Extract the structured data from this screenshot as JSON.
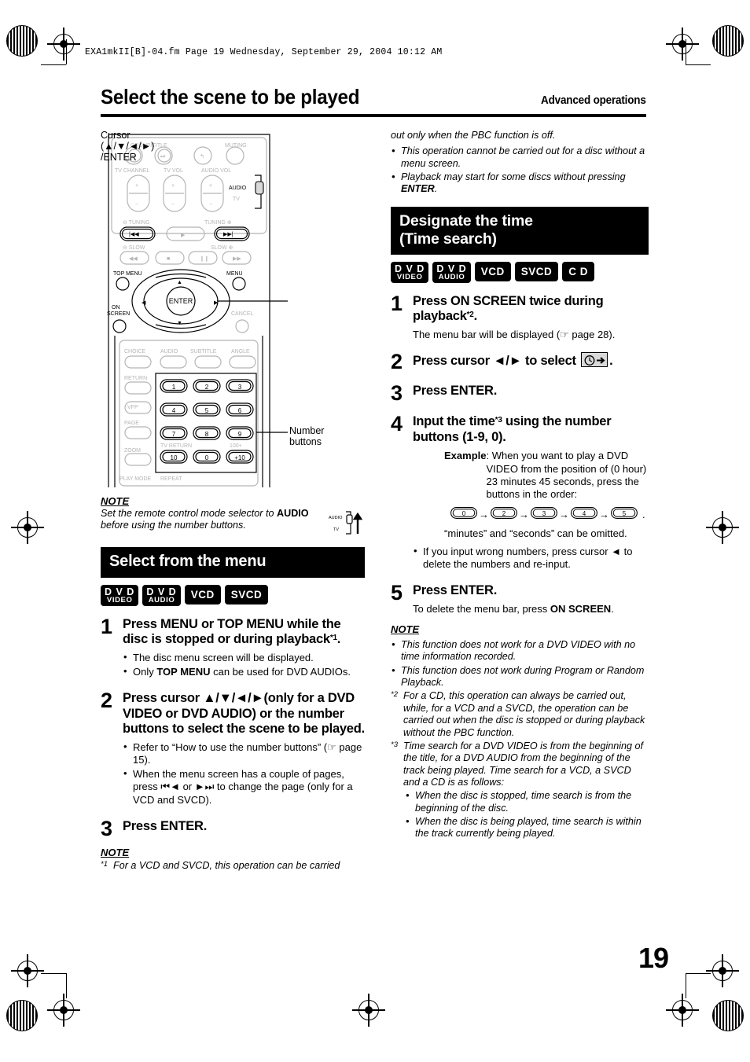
{
  "file_header": "EXA1mkII[B]-04.fm  Page 19  Wednesday, September 29, 2004  10:12 AM",
  "title": {
    "main": "Select the scene to be played",
    "section": "Advanced operations"
  },
  "page_number": "19",
  "remote": {
    "labels": {
      "group_title": "GROUP/TITLE",
      "muting": "MUTING",
      "tv_channel": "TV CHANNEL",
      "tv_vol": "TV VOL",
      "audio_vol": "AUDIO VOL",
      "audio": "AUDIO",
      "tv": "TV",
      "tuning_left": "TUNING",
      "tuning_right": "TUNING",
      "slow_left": "SLOW",
      "slow_right": "SLOW",
      "top_menu": "TOP MENU",
      "menu": "MENU",
      "enter": "ENTER",
      "on_screen": "ON\nSCREEN",
      "cancel": "CANCEL",
      "choice": "CHOICE",
      "audio_btn": "AUDIO",
      "subtitle": "SUBTITLE",
      "angle": "ANGLE",
      "return": "RETURN",
      "vfp": "VFP",
      "page": "PAGE",
      "zoom": "ZOOM",
      "tv_return": "TV RETURN",
      "hundred_plus": "100+",
      "play_mode": "PLAY MODE",
      "repeat": "REPEAT"
    },
    "keys": [
      "1",
      "2",
      "3",
      "4",
      "5",
      "6",
      "7",
      "8",
      "9",
      "10",
      "0",
      "+10"
    ],
    "callouts": {
      "cursor": [
        "Cursor",
        "(▲/▼/◄/►)",
        "/ENTER"
      ],
      "number": [
        "Number",
        "buttons"
      ]
    }
  },
  "left_column": {
    "note_top": {
      "head": "NOTE",
      "text_a": "Set the remote control mode selector to ",
      "text_b": "AUDIO",
      "text_c": " before using the number buttons.",
      "selector_audio": "AUDIO",
      "selector_tv": "TV"
    },
    "banner": "Select from the menu",
    "badges": [
      {
        "type": "two",
        "line1": "D V D",
        "line2": "VIDEO"
      },
      {
        "type": "two",
        "line1": "D V D",
        "line2": "AUDIO"
      },
      {
        "type": "one",
        "label": "VCD"
      },
      {
        "type": "one",
        "label": "SVCD"
      }
    ],
    "steps": [
      {
        "num": "1",
        "title": "Press MENU or TOP MENU while the disc is stopped or during playback",
        "sup": "*1",
        "title_end": ".",
        "bullets": [
          {
            "parts": [
              {
                "t": "The disc menu screen will be displayed."
              }
            ]
          },
          {
            "parts": [
              {
                "t": "Only "
              },
              {
                "t": "TOP MENU",
                "b": true
              },
              {
                "t": " can be used for DVD AUDIOs."
              }
            ]
          }
        ]
      },
      {
        "num": "2",
        "title": "Press cursor ▲/▼/◄/►(only for a DVD VIDEO or DVD AUDIO) or the number buttons to select the scene to be played.",
        "bullets": [
          {
            "parts": [
              {
                "t": "Refer to “How to use the number buttons” (☞ page 15)."
              }
            ]
          },
          {
            "parts": [
              {
                "t": "When the menu screen has a couple of pages, press ⏮◄ or ►⏭ to change the page (only for a VCD and SVCD)."
              }
            ]
          }
        ]
      },
      {
        "num": "3",
        "title": "Press ENTER."
      }
    ],
    "note_bottom": {
      "head": "NOTE",
      "marker": "*1",
      "text": "For a VCD and SVCD, this operation can be carried"
    }
  },
  "right_column": {
    "continued": {
      "first_line": "out only when the PBC function is off.",
      "bullets": [
        {
          "parts": [
            {
              "t": "This operation cannot be carried out for a disc without a menu screen."
            }
          ]
        },
        {
          "parts": [
            {
              "t": "Playback may start for some discs without pressing "
            },
            {
              "t": "ENTER",
              "b": true
            },
            {
              "t": "."
            }
          ]
        }
      ]
    },
    "banner_line1": "Designate the time",
    "banner_line2": "(Time search)",
    "badges": [
      {
        "type": "two",
        "line1": "D V D",
        "line2": "VIDEO"
      },
      {
        "type": "two",
        "line1": "D V D",
        "line2": "AUDIO"
      },
      {
        "type": "one",
        "label": "VCD"
      },
      {
        "type": "one",
        "label": "SVCD"
      },
      {
        "type": "one",
        "label": "C D"
      }
    ],
    "steps": [
      {
        "num": "1",
        "title": "Press ON SCREEN twice during playback",
        "sup": "*2",
        "title_end": ".",
        "sub": "The menu bar will be displayed (☞ page 28)."
      },
      {
        "num": "2",
        "title_pre": "Press cursor ◄/► to select ",
        "title_post": "."
      },
      {
        "num": "3",
        "title": "Press ENTER."
      },
      {
        "num": "4",
        "title_pre": "Input the time",
        "sup": "*3",
        "title_post": " using the number buttons (1-9, 0).",
        "example_label": "Example",
        "example_text": ": When you want to play a DVD VIDEO from the position of (0 hour) 23 minutes 45 seconds, press the buttons in the order:",
        "key_sequence": [
          "0",
          "2",
          "3",
          "4",
          "5"
        ],
        "after_sequence": "“minutes” and “seconds” can be omitted.",
        "bullets": [
          {
            "parts": [
              {
                "t": "If you input wrong numbers, press cursor ◄ to delete the numbers and re-input."
              }
            ]
          }
        ]
      },
      {
        "num": "5",
        "title": "Press ENTER.",
        "sub_parts": [
          {
            "t": "To delete the menu bar, press "
          },
          {
            "t": "ON SCREEN",
            "b": true
          },
          {
            "t": "."
          }
        ]
      }
    ],
    "note": {
      "head": "NOTE",
      "bullets": [
        {
          "t": "This function does not work for a DVD VIDEO with no time information recorded."
        },
        {
          "t": "This function does not work during Program or Random Playback."
        }
      ],
      "footnotes": [
        {
          "marker": "*2",
          "text": "For a CD, this operation can always be carried out, while, for a VCD and a SVCD, the operation can be carried out when the disc is stopped or during playback without the PBC function."
        },
        {
          "marker": "*3",
          "text": "Time search for a DVD VIDEO is from the beginning of the title, for a DVD AUDIO from the beginning of the track being played. Time search for a VCD, a SVCD and a CD is as follows:",
          "sub_bullets": [
            "When the disc is stopped, time search is from the beginning of the disc.",
            "When the disc is being played, time search is within the track currently being played."
          ]
        }
      ]
    }
  }
}
